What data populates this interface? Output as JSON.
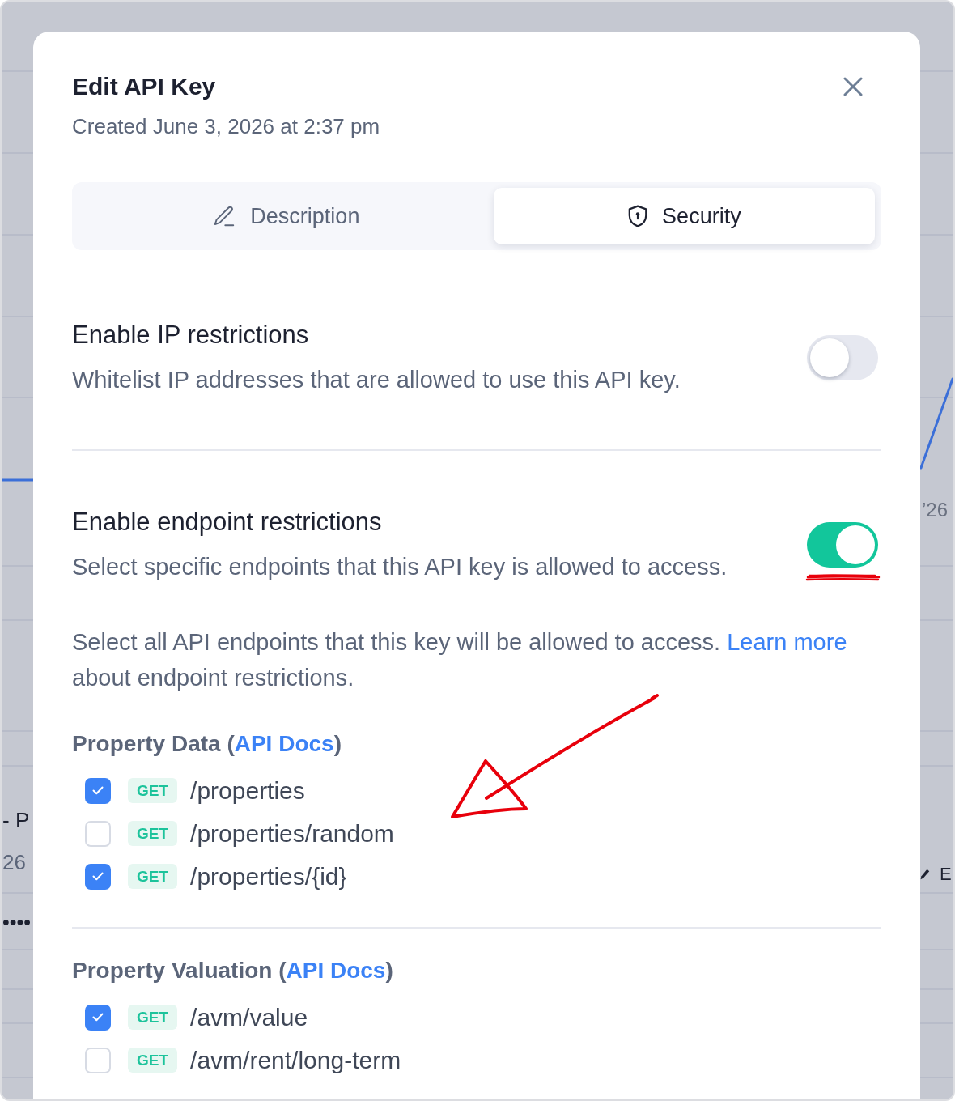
{
  "background": {
    "axis_label": "’26",
    "left_texts": [
      "- P",
      "26"
    ],
    "masked_text": "••••",
    "edit_label": "E"
  },
  "dialog": {
    "title": "Edit API Key",
    "subtitle": "Created June 3, 2026 at 2:37 pm"
  },
  "tabs": [
    {
      "label": "Description",
      "selected": false
    },
    {
      "label": "Security",
      "selected": true
    }
  ],
  "settings": [
    {
      "title": "Enable IP restrictions",
      "description": "Whitelist IP addresses that are allowed to use this API key.",
      "on": false
    },
    {
      "title": "Enable endpoint restrictions",
      "description": "Select specific endpoints that this API key is allowed to access.",
      "on": true
    }
  ],
  "help_text": {
    "before": "Select all API endpoints that this key will be allowed to access. ",
    "link": "Learn more",
    "after": " about endpoint restrictions."
  },
  "groups": [
    {
      "heading_before": "Property Data (",
      "heading_link": "API Docs",
      "heading_after": ")",
      "endpoints": [
        {
          "method": "GET",
          "path": "/properties",
          "checked": true
        },
        {
          "method": "GET",
          "path": "/properties/random",
          "checked": false
        },
        {
          "method": "GET",
          "path": "/properties/{id}",
          "checked": true
        }
      ]
    },
    {
      "heading_before": "Property Valuation (",
      "heading_link": "API Docs",
      "heading_after": ")",
      "endpoints": [
        {
          "method": "GET",
          "path": "/avm/value",
          "checked": true
        },
        {
          "method": "GET",
          "path": "/avm/rent/long-term",
          "checked": false
        }
      ]
    }
  ]
}
